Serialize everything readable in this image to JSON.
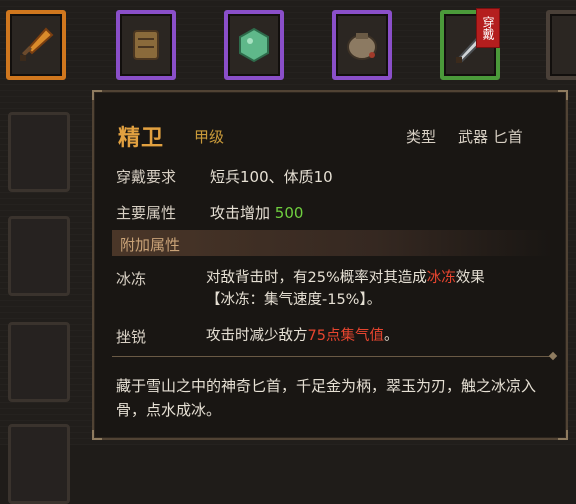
{
  "equipment_bar": {
    "slots": [
      {
        "icon": "dagger-icon",
        "rarity_color": "#d0771e"
      },
      {
        "icon": "leather-armor-icon",
        "rarity_color": "#8a4fc9"
      },
      {
        "icon": "jade-stone-icon",
        "rarity_color": "#8a4fc9"
      },
      {
        "icon": "pouch-icon",
        "rarity_color": "#8a4fc9"
      },
      {
        "icon": "blade-icon",
        "rarity_color": "#4b9a3a",
        "badge": "穿戴"
      }
    ]
  },
  "tooltip": {
    "name": "精卫",
    "grade": "甲级",
    "type_label": "类型",
    "type_value": "武器 匕首",
    "requirements_label": "穿戴要求",
    "requirements_value": "短兵100、体质10",
    "main_attr_label": "主要属性",
    "main_attr_text": "攻击增加",
    "main_attr_value": "500",
    "extra_section_title": "附加属性",
    "effects": [
      {
        "name": "冰冻",
        "line1_pre": "对敌背击时，有25%概率对其造成",
        "line1_hl": "冰冻",
        "line1_post": "效果",
        "line2": "【冰冻：集气速度-15%】。"
      },
      {
        "name": "挫锐",
        "line1_pre": "攻击时减少敌方",
        "line1_hl": "75点集气值",
        "line1_post": "。"
      }
    ],
    "description": "藏于雪山之中的神奇匕首，千足金为柄，翠玉为刃，触之冰凉入骨，点水成冰。"
  },
  "colors": {
    "name": "#e2a140",
    "highlight_green": "#6fcf3f",
    "highlight_red": "#e6452f"
  }
}
